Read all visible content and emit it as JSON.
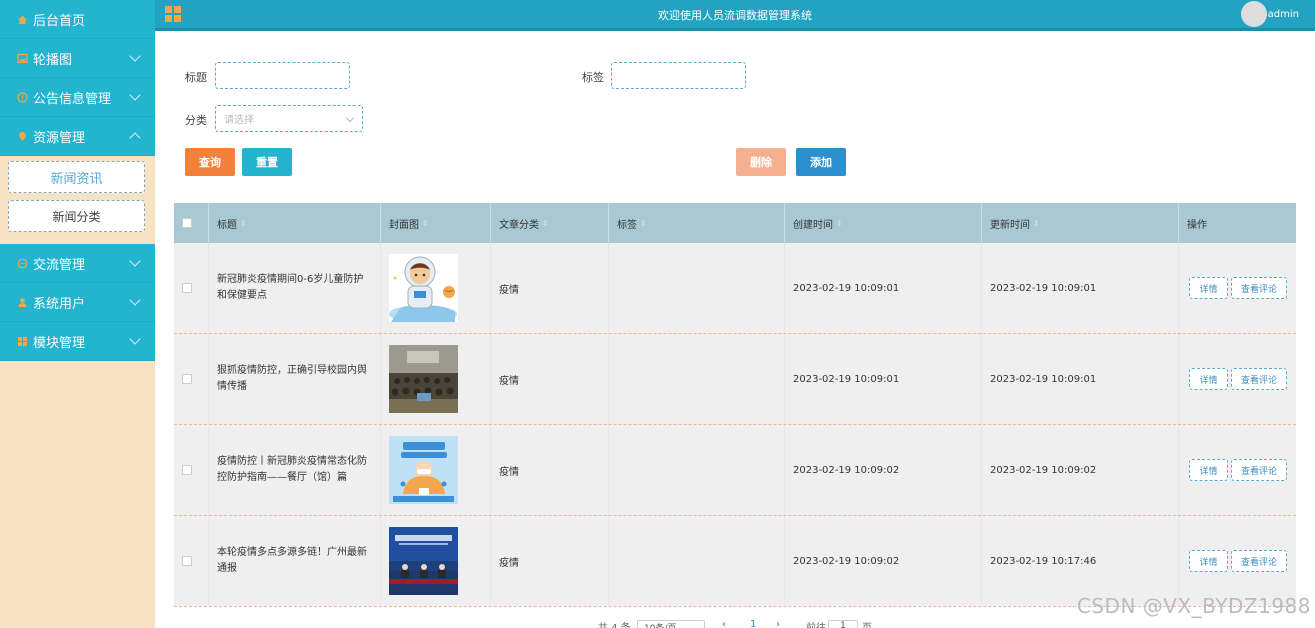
{
  "sidebar": {
    "items": [
      {
        "label": "后台首页",
        "icon": "home-icon"
      },
      {
        "label": "轮播图",
        "icon": "image-icon"
      },
      {
        "label": "公告信息管理",
        "icon": "info-icon"
      },
      {
        "label": "资源管理",
        "icon": "pin-icon"
      },
      {
        "label": "交流管理",
        "icon": "chat-icon"
      },
      {
        "label": "系统用户",
        "icon": "user-icon"
      },
      {
        "label": "模块管理",
        "icon": "grid-icon"
      }
    ],
    "submenu": [
      {
        "label": "新闻资讯"
      },
      {
        "label": "新闻分类"
      }
    ]
  },
  "header": {
    "title": "欢迎使用人员流调数据管理系统",
    "username": "admin"
  },
  "search": {
    "title_label": "标题",
    "tag_label": "标签",
    "category_label": "分类",
    "category_placeholder": "请选择",
    "title_value": "",
    "tag_value": ""
  },
  "buttons": {
    "query": "查询",
    "reset": "重置",
    "delete": "删除",
    "add": "添加"
  },
  "table": {
    "headers": [
      "标题",
      "封面图",
      "文章分类",
      "标签",
      "创建时间",
      "更新时间",
      "操作"
    ],
    "detail_label": "详情",
    "comment_label": "查看评论",
    "rows": [
      {
        "title": "新冠肺炎疫情期间0-6岁儿童防护和保健要点",
        "category": "疫情",
        "tag": "",
        "created": "2023-02-19 10:09:01",
        "updated": "2023-02-19 10:09:01"
      },
      {
        "title": "狠抓疫情防控，正确引导校园内舆情传播",
        "category": "疫情",
        "tag": "",
        "created": "2023-02-19 10:09:01",
        "updated": "2023-02-19 10:09:01"
      },
      {
        "title": "疫情防控丨新冠肺炎疫情常态化防控防护指南——餐厅（馆）篇",
        "category": "疫情",
        "tag": "",
        "created": "2023-02-19 10:09:02",
        "updated": "2023-02-19 10:09:02"
      },
      {
        "title": "本轮疫情多点多源多链！广州最新通报",
        "category": "疫情",
        "tag": "",
        "created": "2023-02-19 10:09:02",
        "updated": "2023-02-19 10:17:46"
      }
    ]
  },
  "pagination": {
    "total": "共 4 条",
    "page_size": "10条/页",
    "goto": "前往",
    "page": "1",
    "page_suffix": "页"
  },
  "watermark": "CSDN @VX_BYDZ1988",
  "colors": {
    "header": "#23a3c1",
    "sidebar_item": "#23b4cf",
    "sidebar_bg": "#f7e2c2",
    "query_btn": "#f3803b",
    "reset_btn": "#23b4cf",
    "delete_btn": "#f4b091",
    "add_btn": "#2e8fd0",
    "table_header": "#a8c9d2"
  }
}
